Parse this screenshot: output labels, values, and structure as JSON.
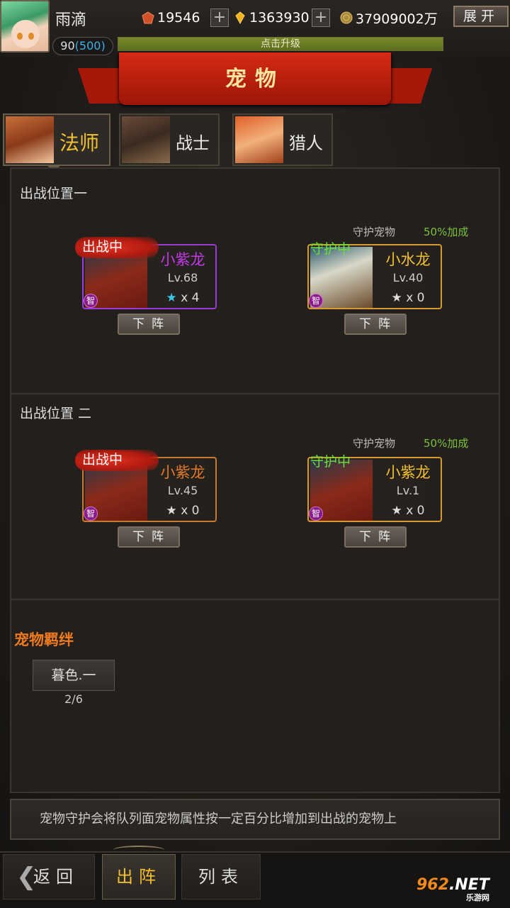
{
  "header": {
    "username": "雨滴",
    "resources": [
      {
        "icon": "red-gem-icon",
        "value": "19546"
      },
      {
        "icon": "diamond-icon",
        "value": "1363930"
      },
      {
        "icon": "gold-coin-icon",
        "value": "37909002万"
      }
    ],
    "plus_label": "+",
    "expand_label": "展开",
    "level": "90",
    "level_extra": "(500)",
    "xp_label": "点击升级"
  },
  "title": "宠物",
  "class_tabs": [
    {
      "label": "法师",
      "active": true
    },
    {
      "label": "战士",
      "active": false
    },
    {
      "label": "猎人",
      "active": false
    }
  ],
  "positions": [
    {
      "label": "出战位置一",
      "guard_header": "守护宠物",
      "bonus": "50%加成",
      "fight": {
        "tag": "出战中",
        "name": "小紫龙",
        "name_color": "#c13ae8",
        "border": "#9a3ad8",
        "level": "Lv.68",
        "star_glyph": "★",
        "star_color": "#3ac8e8",
        "stars": "x 4",
        "button": "下阵"
      },
      "guard": {
        "tag": "守护中",
        "name": "小水龙",
        "name_color": "#f2c030",
        "border": "#d89a30",
        "level": "Lv.40",
        "star_glyph": "★",
        "star_color": "#dddddd",
        "stars": "x 0",
        "button": "下阵"
      }
    },
    {
      "label": "出战位置 二",
      "guard_header": "守护宠物",
      "bonus": "50%加成",
      "fight": {
        "tag": "出战中",
        "name": "小紫龙",
        "name_color": "#e07a2a",
        "border": "#c87a30",
        "level": "Lv.45",
        "star_glyph": "★",
        "star_color": "#dddddd",
        "stars": "x 0",
        "button": "下阵"
      },
      "guard": {
        "tag": "守护中",
        "name": "小紫龙",
        "name_color": "#f2c030",
        "border": "#d89a30",
        "level": "Lv.1",
        "star_glyph": "★",
        "star_color": "#dddddd",
        "stars": "x 0",
        "button": "下阵"
      }
    }
  ],
  "wisdom_badge": "智",
  "bond": {
    "title": "宠物羁绊",
    "item": "暮色.一",
    "count": "2/6"
  },
  "tip": "宠物守护会将队列面宠物属性按一定百分比增加到出战的宠物上",
  "bottom_nav": {
    "back": "返回",
    "back_icon": "chevron-left-icon",
    "deploy": "出阵",
    "list": "列表"
  },
  "watermark": {
    "prefix": "962",
    "suffix": ".NET",
    "sub": "乐游网"
  }
}
